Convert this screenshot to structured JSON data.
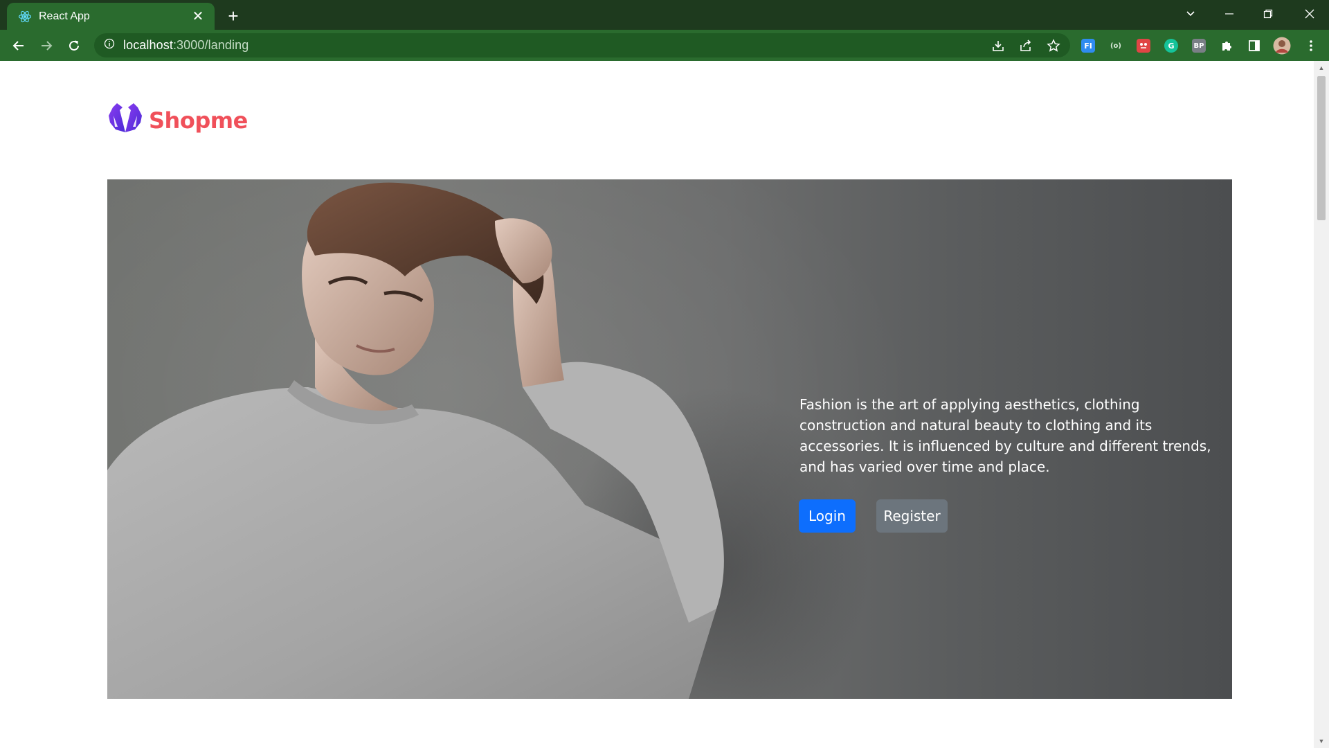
{
  "browser": {
    "tab_title": "React App",
    "url_host": "localhost",
    "url_path": ":3000/landing",
    "extensions": [
      {
        "name": "fi-extension-icon",
        "label": "FI",
        "color": "#2f8cf0"
      },
      {
        "name": "bracket-extension-icon",
        "label": "(o)",
        "color": "#2a6b2e"
      },
      {
        "name": "red-extension-icon",
        "label": "",
        "color": "#e04545"
      },
      {
        "name": "grammarly-icon",
        "label": "G",
        "color": "#15c39a"
      },
      {
        "name": "bp-extension-icon",
        "label": "BP",
        "color": "#7a7f86"
      }
    ]
  },
  "page": {
    "brand": "Shopme",
    "hero_text": "Fashion is the art of applying aesthetics, clothing construction and natural beauty to clothing and its accessories. It is influenced by culture and different trends, and has varied over time and place.",
    "login_label": "Login",
    "register_label": "Register"
  }
}
